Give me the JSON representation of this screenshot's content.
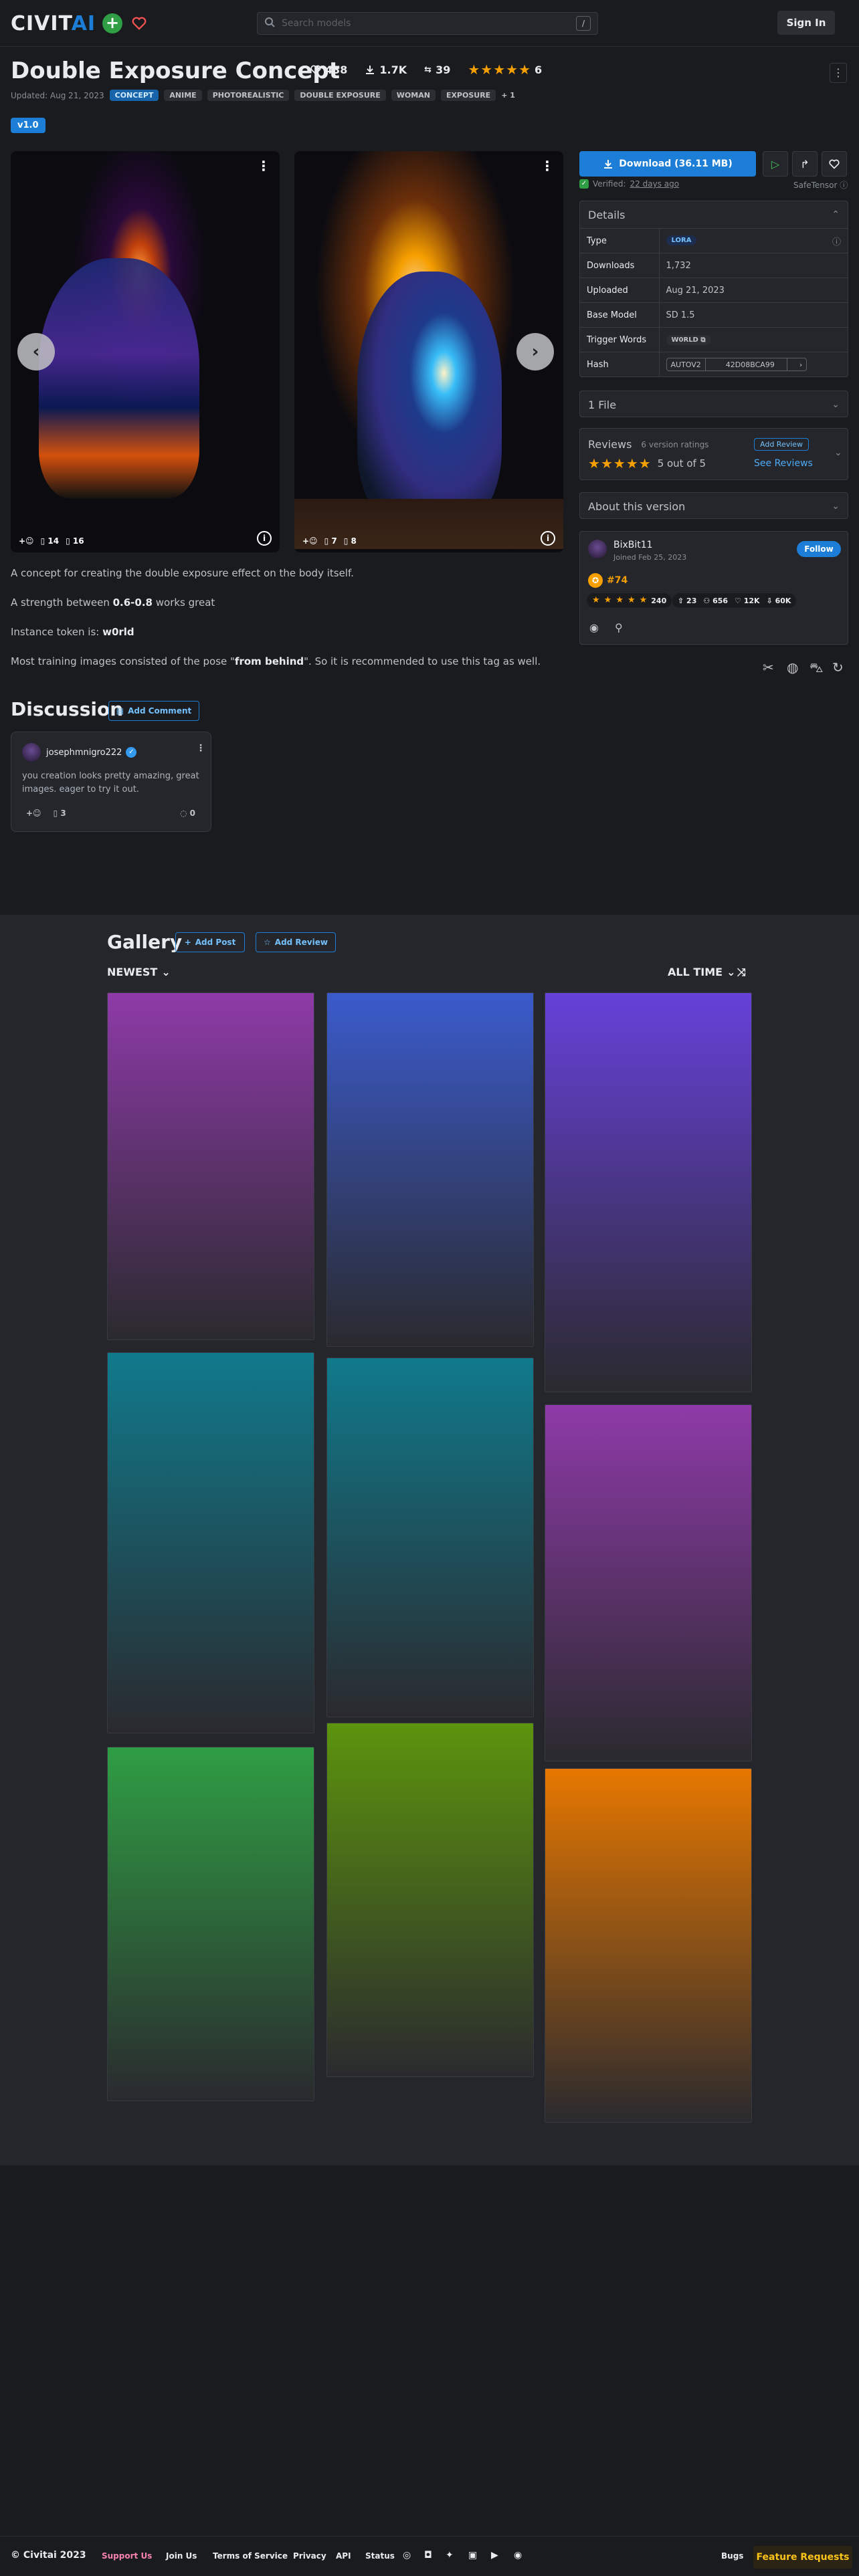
{
  "header": {
    "logo_main": "CIVIT",
    "logo_accent": "AI",
    "search_placeholder": "Search models",
    "search_shortcut": "/",
    "signin_label": "Sign In"
  },
  "model": {
    "title": "Double Exposure Concept",
    "stats": {
      "likes": "438",
      "downloads": "1.7K",
      "collections": "39",
      "rating_count": "6",
      "stars": 5
    },
    "updated": "Updated: Aug 21, 2023",
    "tags": [
      "CONCEPT",
      "ANIME",
      "PHOTOREALISTIC",
      "DOUBLE EXPOSURE",
      "WOMAN",
      "EXPOSURE"
    ],
    "more_tags": "+ 1",
    "version": "v1.0"
  },
  "carousel": {
    "images": [
      {
        "reactions": "14",
        "comments": "16"
      },
      {
        "reactions": "7",
        "comments": "8"
      }
    ]
  },
  "description": {
    "p1": "A concept for creating the double exposure effect on the body itself.",
    "p2_before": "A strength between ",
    "p2_bold": "0.6-0.8",
    "p2_after": " works great",
    "p3_before": "Instance token is: ",
    "p3_bold": "w0rld",
    "p4_before": "Most training images consisted of the pose \"",
    "p4_bold": "from behind",
    "p4_after": "\". So it is recommended to use this tag as well."
  },
  "sidebar": {
    "download_label": "Download (36.11 MB)",
    "verified_label": "Verified:",
    "verified_time": "22 days ago",
    "safetensor": "SafeTensor",
    "details_title": "Details",
    "details": [
      {
        "key": "Type",
        "value": "LORA"
      },
      {
        "key": "Downloads",
        "value": "1,732"
      },
      {
        "key": "Uploaded",
        "value": "Aug 21, 2023"
      },
      {
        "key": "Base Model",
        "value": "SD 1.5"
      },
      {
        "key": "Trigger Words",
        "value": "W0RLD"
      },
      {
        "key": "Hash",
        "value": "AUTOV2",
        "value2": "42D08BCA99"
      }
    ],
    "files_title": "1 File",
    "reviews": {
      "title": "Reviews",
      "subtitle": "6 version ratings",
      "score": "5 out of 5",
      "add_label": "Add Review",
      "see_label": "See Reviews",
      "stars": 5
    },
    "about_title": "About this version",
    "creator": {
      "name": "BixBit11",
      "joined": "Joined Feb 25, 2023",
      "follow_label": "Follow",
      "rank": "#74",
      "rating": "240",
      "uploads": "23",
      "followers": "656",
      "likes": "12K",
      "downloads": "60K",
      "stars": 5
    }
  },
  "discussion": {
    "title": "Discussion",
    "add_label": "Add Comment",
    "comment": {
      "user": "josephmnigro222",
      "text": "you creation looks pretty amazing, great images. eager to try it out.",
      "reactions": "3",
      "replies": "0"
    }
  },
  "gallery": {
    "title": "Gallery",
    "add_post": "Add Post",
    "add_review": "Add Review",
    "sort": "NEWEST",
    "period": "ALL TIME",
    "tiles": [
      {
        "top": "#8e3aa8",
        "bottom": "#2a2a2e"
      },
      {
        "top": "#3b5bcc",
        "bottom": "#2a2a2e"
      },
      {
        "top": "#6741d9",
        "bottom": "#2a2a2e"
      },
      {
        "top": "#107a8c",
        "bottom": "#2a2a2e"
      },
      {
        "top": "#107a8c",
        "bottom": "#2a2a2e"
      },
      {
        "top": "#8e3aa8",
        "bottom": "#2a2a2e"
      },
      {
        "top": "#2f9e44",
        "bottom": "#2a2a2e"
      },
      {
        "top": "#5c940d",
        "bottom": "#2a2a2e"
      },
      {
        "top": "#e67700",
        "bottom": "#2a2a2e"
      }
    ]
  },
  "footer": {
    "copyright": "© Civitai 2023",
    "links": [
      "Support Us",
      "Join Us",
      "Terms of Service",
      "Privacy",
      "API",
      "Status"
    ],
    "bugs": "Bugs",
    "feature": "Feature Requests"
  }
}
